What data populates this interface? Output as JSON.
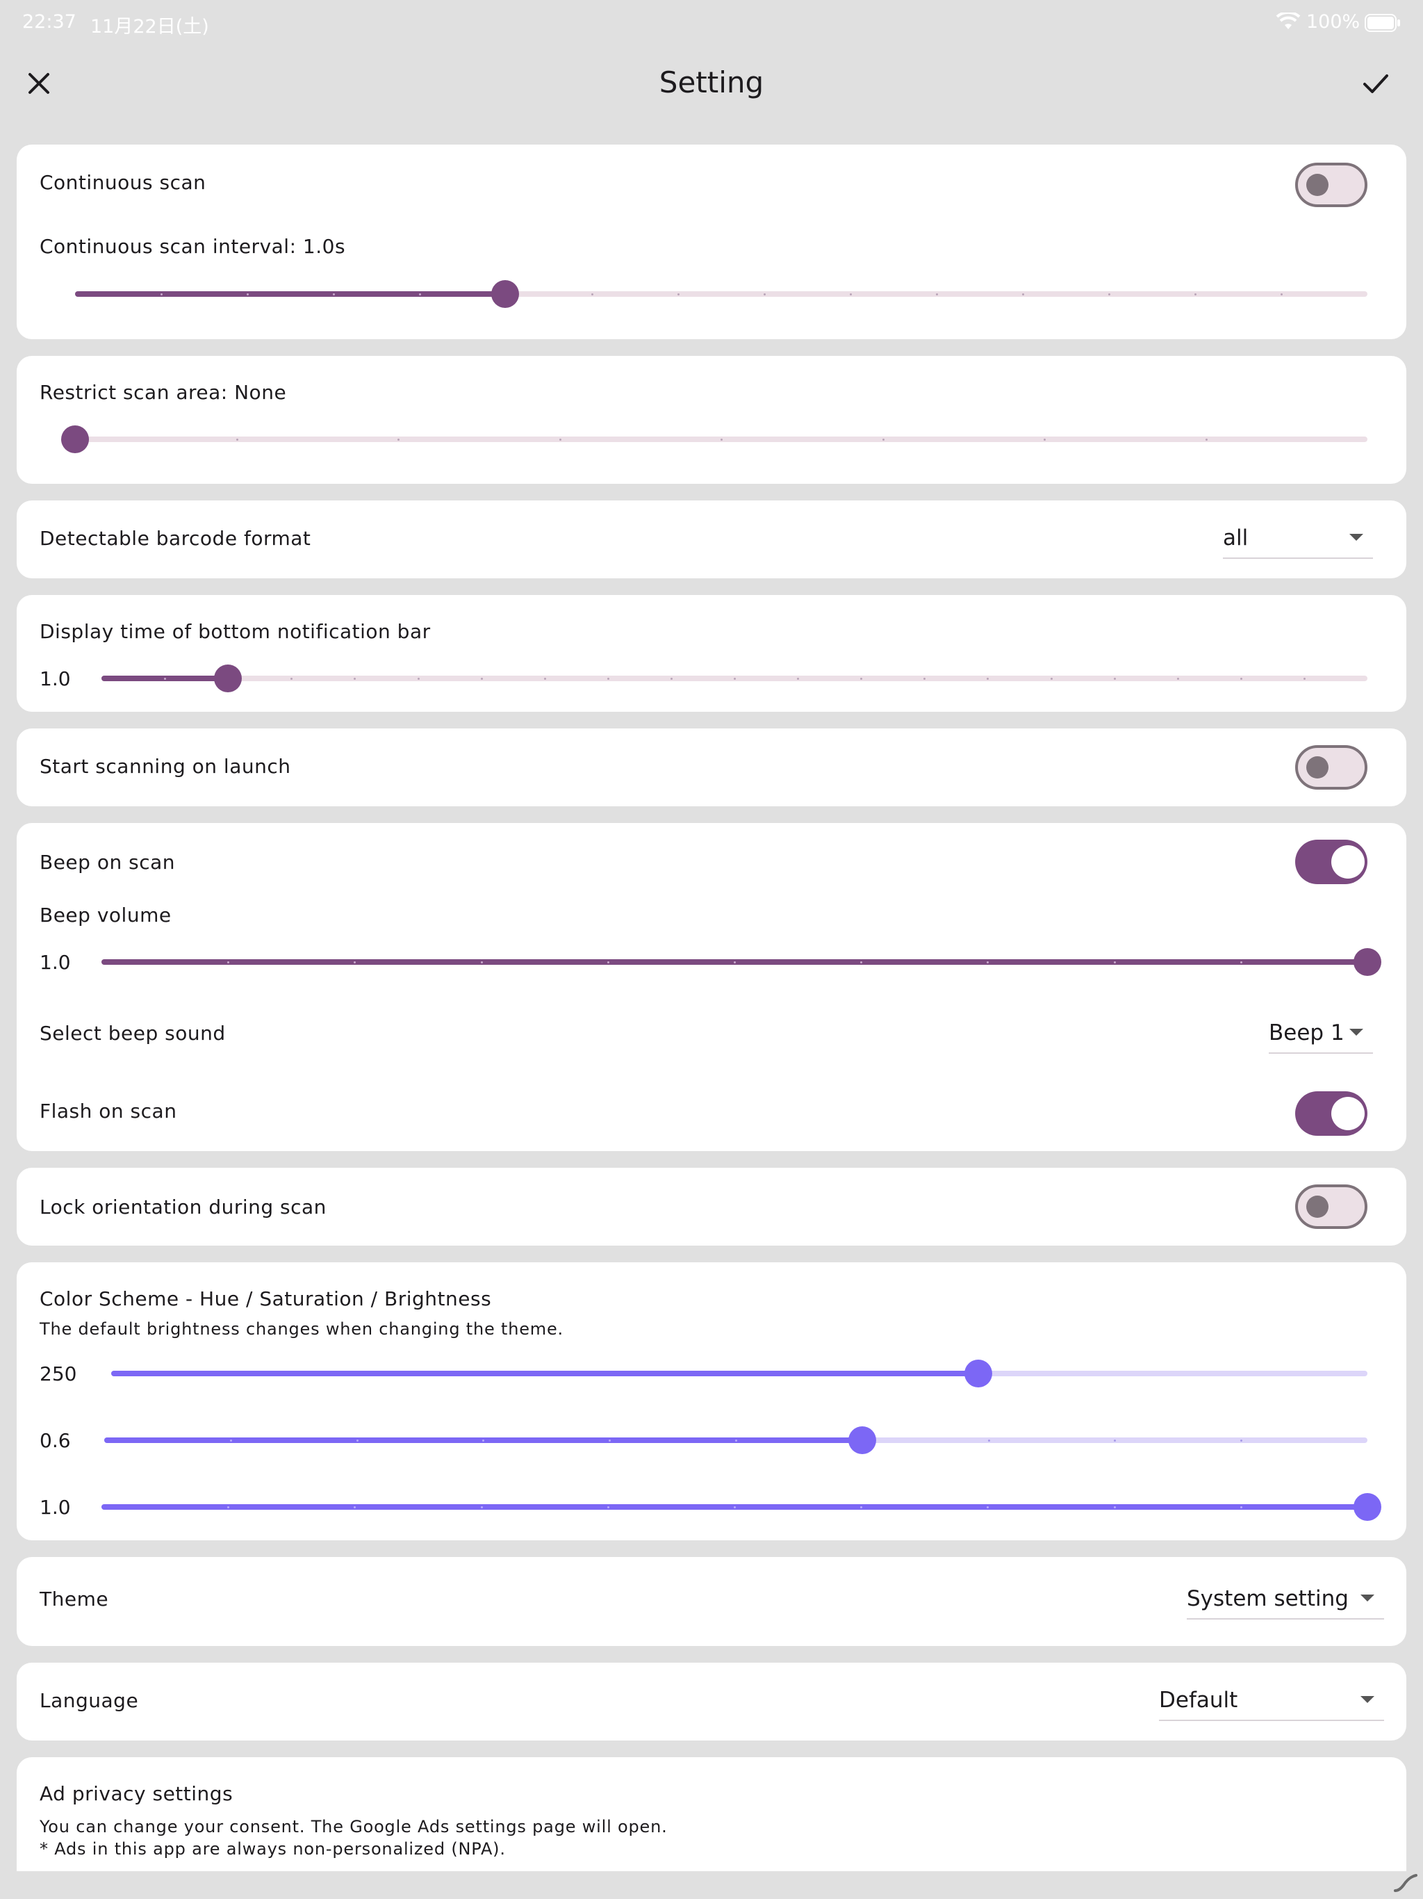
{
  "status_bar": {
    "time": "22:37",
    "date": "11月22日(土)",
    "battery": "100%"
  },
  "app_bar": {
    "title": "Setting",
    "close_icon": "close-icon",
    "confirm_icon": "check-icon"
  },
  "continuous_scan": {
    "label": "Continuous scan",
    "enabled": false
  },
  "scan_interval": {
    "label": "Continuous scan interval: 1.0s",
    "value_fraction": 0.333,
    "divisions": 15
  },
  "restrict_scan_area": {
    "label": "Restrict scan area: None",
    "value_fraction": 0.0,
    "divisions": 8
  },
  "barcode_format": {
    "label": "Detectable barcode format",
    "value": "all"
  },
  "notification_bar": {
    "label": "Display time of bottom notification bar",
    "value": "1.0",
    "value_fraction": 0.1,
    "divisions": 20
  },
  "start_scanning": {
    "label": "Start scanning on launch",
    "enabled": false
  },
  "beep": {
    "label": "Beep on scan",
    "enabled": true,
    "volume_label": "Beep volume",
    "volume_value": "1.0",
    "volume_fraction": 1.0,
    "divisions": 10,
    "sound_label": "Select beep sound",
    "sound_value": "Beep 1",
    "flash_label": "Flash on scan",
    "flash_enabled": true
  },
  "lock_orientation": {
    "label": "Lock orientation during scan",
    "enabled": false
  },
  "color_scheme": {
    "label": "Color Scheme - Hue / Saturation / Brightness",
    "description": "The default brightness changes when changing the theme.",
    "hue_value": "250",
    "hue_fraction": 0.69,
    "saturation_value": "0.6",
    "saturation_fraction": 0.6,
    "saturation_divisions": 10,
    "brightness_value": "1.0",
    "brightness_fraction": 1.0,
    "brightness_divisions": 10
  },
  "theme": {
    "label": "Theme",
    "value": "System setting"
  },
  "language": {
    "label": "Language",
    "value": "Default"
  },
  "ad_privacy": {
    "label": "Ad privacy settings",
    "line1": "You can change your consent. The Google Ads settings page will open.",
    "line2": "* Ads in this app are always non-personalized (NPA)."
  },
  "colors": {
    "primary": "#7b4a80",
    "primary_inactive": "#ecdfe6",
    "accent": "#7c67f5",
    "accent_inactive": "#dcd5f9"
  }
}
